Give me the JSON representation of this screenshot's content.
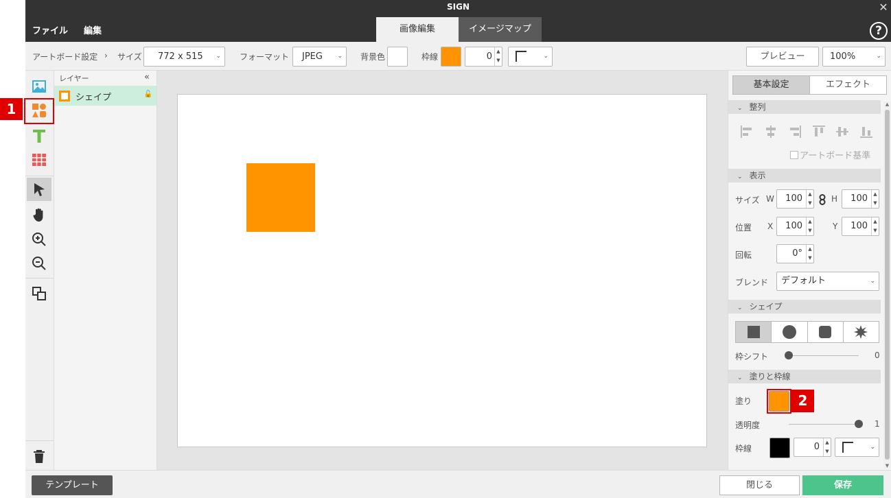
{
  "window": {
    "title": "SIGN",
    "menu": {
      "file": "ファイル",
      "edit": "編集"
    },
    "mode_tabs": {
      "image_edit": "画像編集",
      "image_map": "イメージマップ"
    },
    "help_glyph": "?"
  },
  "toolbar": {
    "artboard_settings": "アートボード設定",
    "separator": "›",
    "size_label": "サイズ",
    "size_value": "772 x 515",
    "format_label": "フォーマット",
    "format_value": "JPEG",
    "bg_color_label": "背景色",
    "bg_color": "#ffffff",
    "stroke_label": "枠線",
    "stroke_color": "#ff9400",
    "stroke_width": "0",
    "preview_label": "プレビュー",
    "zoom_value": "100%"
  },
  "tools": [
    "image-icon",
    "shapes-icon",
    "text-icon",
    "table-icon",
    "select-arrow-icon",
    "hand-icon",
    "zoom-in-icon",
    "zoom-out-icon",
    "duplicate-icon",
    "trash-icon"
  ],
  "layers": {
    "header": "レイヤー",
    "collapse_glyph": "«",
    "items": [
      {
        "name": "シェイプ",
        "color": "#ff9400"
      }
    ]
  },
  "canvas": {
    "shape_color": "#ff9400"
  },
  "properties": {
    "tabs": {
      "basic": "基本設定",
      "effect": "エフェクト"
    },
    "align": {
      "title": "整列",
      "artboard_reference": "アートボード基準"
    },
    "display": {
      "title": "表示",
      "size_label": "サイズ",
      "w_label": "W",
      "w_value": "100",
      "h_label": "H",
      "h_value": "100",
      "position_label": "位置",
      "x_label": "X",
      "x_value": "100",
      "y_label": "Y",
      "y_value": "100",
      "rotation_label": "回転",
      "rotation_value": "0°",
      "blend_label": "ブレンド",
      "blend_value": "デフォルト"
    },
    "shape": {
      "title": "シェイプ",
      "border_shift_label": "枠シフト",
      "border_shift_value": "0"
    },
    "fill_stroke": {
      "title": "塗りと枠線",
      "fill_label": "塗り",
      "fill_color": "#ff9400",
      "opacity_label": "透明度",
      "opacity_value": "1",
      "stroke_label": "枠線",
      "stroke_color": "#000000",
      "stroke_width": "0"
    }
  },
  "bottom": {
    "template": "テンプレート",
    "close": "閉じる",
    "save": "保存"
  },
  "callouts": [
    "1",
    "2"
  ]
}
